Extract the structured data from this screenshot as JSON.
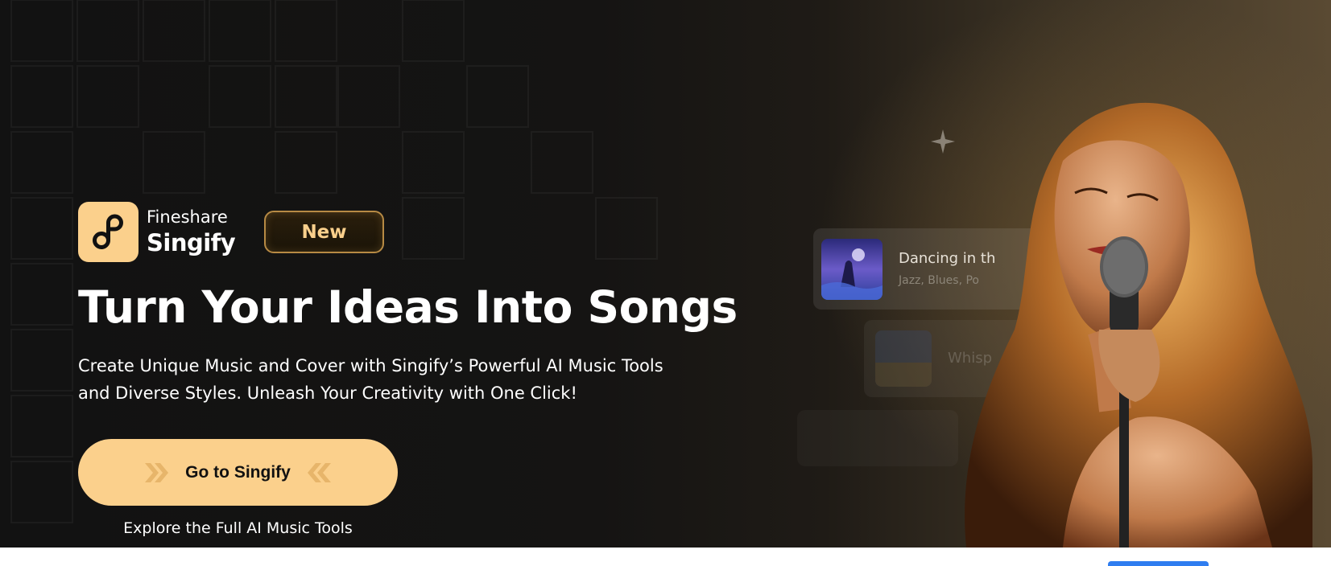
{
  "brand": {
    "name_line1": "Fineshare",
    "name_line2": "Singify",
    "logo_icon": "music-note-logo-icon",
    "accent_color": "#fbd08c"
  },
  "badge": {
    "label": "New"
  },
  "hero": {
    "headline": "Turn Your Ideas Into Songs",
    "subline_1": "Create Unique Music and Cover with Singify’s Powerful AI Music Tools",
    "subline_2": "and Diverse Styles. Unleash Your Creativity with One Click!"
  },
  "cta": {
    "label": "Go to Singify",
    "sub_label": "Explore the Full AI Music Tools",
    "left_icon": "double-chevron-right-icon",
    "right_icon": "double-chevron-left-icon"
  },
  "song_cards": [
    {
      "title": "Dancing in th",
      "tags": "Jazz, Blues, Po"
    },
    {
      "title": "Whisp"
    }
  ],
  "colors": {
    "background": "#121212",
    "button": "#fbd08c",
    "badge_border": "#b78a44",
    "text": "#ffffff"
  }
}
